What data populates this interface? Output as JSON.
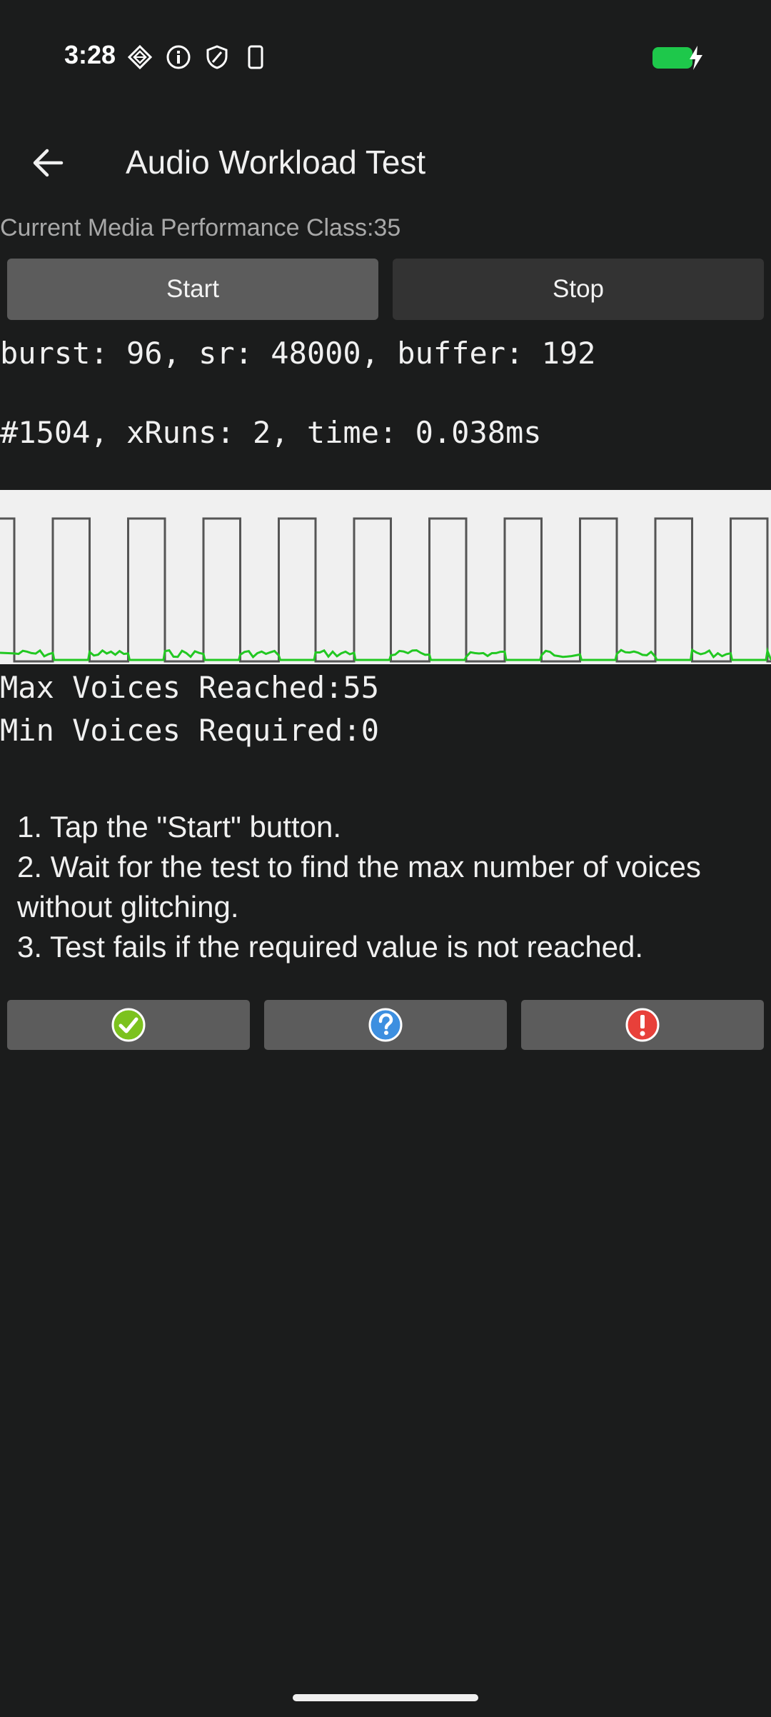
{
  "status_bar": {
    "time": "3:28",
    "icons": [
      "diamond-icon",
      "info-icon",
      "shield-icon",
      "phone-icon"
    ],
    "battery_color": "#1ec84b"
  },
  "app_bar": {
    "title": "Audio Workload Test",
    "back_icon": "arrow-left-icon"
  },
  "media_performance": {
    "label": "Current Media Performance Class:35"
  },
  "buttons": {
    "start_label": "Start",
    "stop_label": "Stop"
  },
  "stats": {
    "line1": "burst: 96, sr: 48000, buffer: 192",
    "line2": "#1504, xRuns: 2, time: 0.038ms"
  },
  "graph": {
    "background": "#f0f0f0",
    "load_color": "#555555",
    "trace_color": "#22c822"
  },
  "voices": {
    "max_reached": "Max Voices Reached:55",
    "min_required": "Min Voices Required:0"
  },
  "instructions": [
    "1. Tap the \"Start\" button.",
    "2. Wait for the test to find the max number of voices without glitching.",
    "3. Test fails if the required value is not reached."
  ],
  "result_buttons": [
    {
      "icon": "check-pass-icon",
      "color": "#7cc21e"
    },
    {
      "icon": "question-info-icon",
      "color": "#3d8fe0"
    },
    {
      "icon": "exclamation-fail-icon",
      "color": "#e8403a"
    }
  ]
}
